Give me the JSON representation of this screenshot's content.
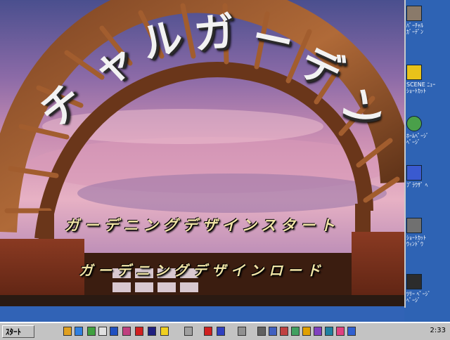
{
  "app": {
    "title_chars": [
      "チ",
      "ャ",
      "ル",
      "ガ",
      "ー",
      "デ",
      "ン"
    ],
    "menu": {
      "start_label": "ガーデニングデザインスタート",
      "load_label": "ガーデニングデザインロード"
    }
  },
  "desktop_icons": [
    {
      "icon": "portrait-icon",
      "label": "ﾊﾞｰﾁｬﾙ\nｶﾞｰﾃﾞﾝ",
      "color": "#8a7a6a"
    },
    {
      "icon": "folder-icon",
      "label": "SCENE ﾆｭｰ\nｼｮｰﾄｶｯﾄ",
      "color": "#e8c21a"
    },
    {
      "icon": "globe-icon",
      "label": "ﾎｰﾑﾍﾟｰｼﾞ\nﾍﾟｰｼﾞ",
      "color": "#4aa04a"
    },
    {
      "icon": "window-icon",
      "label": "ﾌﾞﾗｳｻﾞ ﾍ",
      "color": "#3a5ad0"
    },
    {
      "icon": "eye-icon",
      "label": "ｼｮｰﾄｶｯﾄ\nｳｨﾝﾄﾞｳ",
      "color": "#707070"
    },
    {
      "icon": "tree-icon",
      "label": "ﾂﾘｰ ﾍﾟｰｼﾞ\nﾍﾟｰｼﾞ",
      "color": "#2c2c2c"
    }
  ],
  "taskbar": {
    "start_label": "ｽﾀｰﾄ",
    "clock": "2:33",
    "icon_names": [
      "explorer-icon",
      "folder-icon",
      "mail-icon",
      "window-icon",
      "notepad-icon",
      "paint-icon",
      "game-icon",
      "terminal-icon",
      "help-icon",
      "arrow-icon",
      "pdf-icon",
      "doc-icon",
      "separator-icon",
      "speaker-icon",
      "tray-icon",
      "tray-icon-2",
      "tray-icon-3",
      "tray-icon-4",
      "tray-icon-5",
      "tray-icon-6",
      "tray-icon-7",
      "tray-icon-8"
    ]
  }
}
